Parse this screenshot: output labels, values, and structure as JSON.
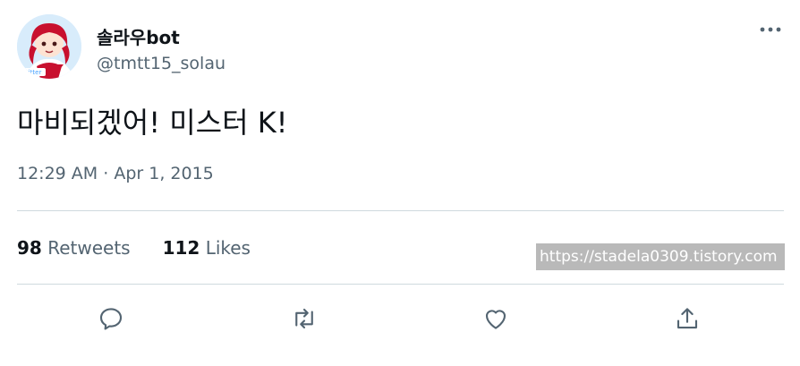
{
  "tweet": {
    "display_name": "솔라우bot",
    "handle": "@tmtt15_solau",
    "text": "마비되겠어! 미스터 K!",
    "time": "12:29 AM",
    "separator": "·",
    "date": "Apr 1, 2015",
    "more_icon": "more-horizontal-icon"
  },
  "stats": {
    "retweets_count": "98",
    "retweets_label": "Retweets",
    "likes_count": "112",
    "likes_label": "Likes"
  },
  "watermark": "https://stadela0309.tistory.com",
  "actions": [
    {
      "icon": "reply-icon"
    },
    {
      "icon": "retweet-icon"
    },
    {
      "icon": "like-icon"
    },
    {
      "icon": "share-icon"
    }
  ],
  "colors": {
    "text_primary": "#0f1419",
    "text_secondary": "#536471",
    "divider": "#cfd9de",
    "watermark_bg": "#b9b9b9"
  }
}
